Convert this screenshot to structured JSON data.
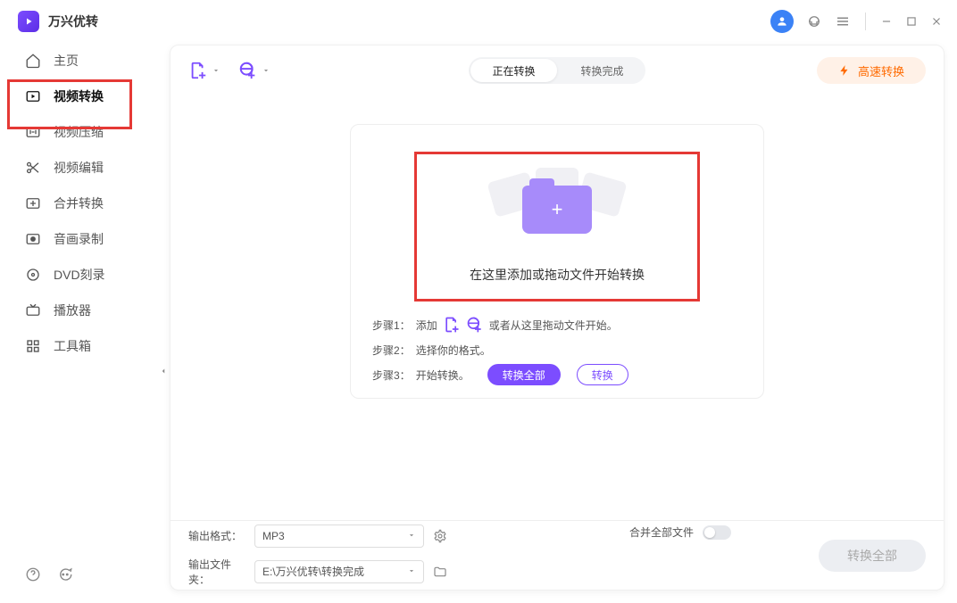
{
  "app": {
    "title": "万兴优转"
  },
  "sidebar": {
    "items": [
      {
        "label": "主页"
      },
      {
        "label": "视频转换"
      },
      {
        "label": "视频压缩"
      },
      {
        "label": "视频编辑"
      },
      {
        "label": "合并转换"
      },
      {
        "label": "音画录制"
      },
      {
        "label": "DVD刻录"
      },
      {
        "label": "播放器"
      },
      {
        "label": "工具箱"
      }
    ]
  },
  "tabs": {
    "active": "正在转换",
    "inactive": "转换完成"
  },
  "fast_convert": "高速转换",
  "drop": {
    "text": "在这里添加或拖动文件开始转换"
  },
  "steps": {
    "s1_label": "步骤1：",
    "s1_text": "添加",
    "s1_tail": "或者从这里拖动文件开始。",
    "s2_label": "步骤2：",
    "s2_text": "选择你的格式。",
    "s3_label": "步骤3：",
    "s3_text": "开始转换。",
    "convert_all_pill": "转换全部",
    "convert_pill": "转换"
  },
  "bottom": {
    "format_label": "输出格式：",
    "format_value": "MP3",
    "folder_label": "输出文件夹：",
    "folder_value": "E:\\万兴优转\\转换完成",
    "merge_label": "合并全部文件",
    "convert_all": "转换全部"
  }
}
